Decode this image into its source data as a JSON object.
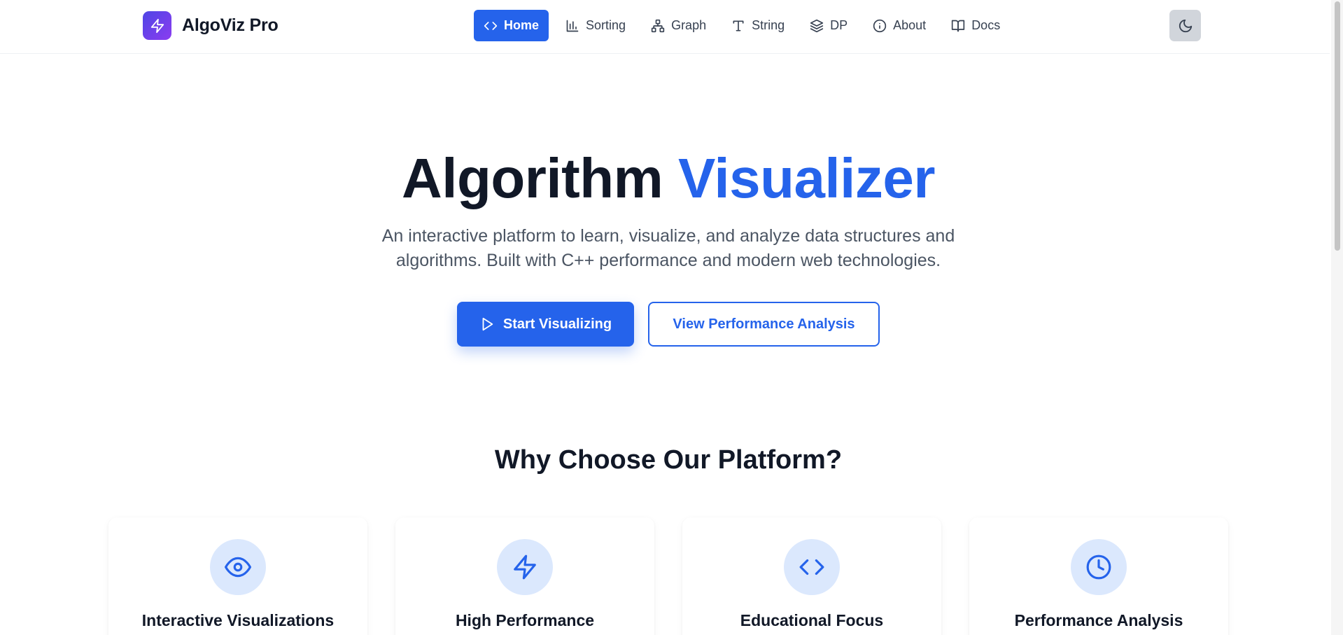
{
  "app": {
    "name": "AlgoViz Pro",
    "logo_icon": "lightning-icon"
  },
  "nav": {
    "items": [
      {
        "label": "Home",
        "icon": "code-icon",
        "active": true
      },
      {
        "label": "Sorting",
        "icon": "bar-chart-icon",
        "active": false
      },
      {
        "label": "Graph",
        "icon": "network-icon",
        "active": false
      },
      {
        "label": "String",
        "icon": "type-icon",
        "active": false
      },
      {
        "label": "DP",
        "icon": "layers-icon",
        "active": false
      },
      {
        "label": "About",
        "icon": "info-icon",
        "active": false
      },
      {
        "label": "Docs",
        "icon": "book-icon",
        "active": false
      }
    ],
    "theme_toggle_icon": "moon-icon"
  },
  "hero": {
    "title_main": "Algorithm",
    "title_accent": "Visualizer",
    "subtitle_line1": "An interactive platform to learn, visualize, and analyze data structures and",
    "subtitle_line2": "algorithms. Built with C++ performance and modern web technologies.",
    "primary_button": "Start Visualizing",
    "secondary_button": "View Performance Analysis"
  },
  "features": {
    "heading": "Why Choose Our Platform?",
    "cards": [
      {
        "title": "Interactive Visualizations",
        "icon": "eye-icon"
      },
      {
        "title": "High Performance",
        "icon": "lightning-icon"
      },
      {
        "title": "Educational Focus",
        "icon": "code-icon"
      },
      {
        "title": "Performance Analysis",
        "icon": "clock-icon"
      }
    ]
  },
  "colors": {
    "accent": "#2563eb",
    "brand_gradient_start": "#4f46e5",
    "brand_gradient_end": "#8b3cf0",
    "icon_circle_bg": "#dbe8fd",
    "heading_text": "#111827",
    "body_text": "#4b5563"
  }
}
